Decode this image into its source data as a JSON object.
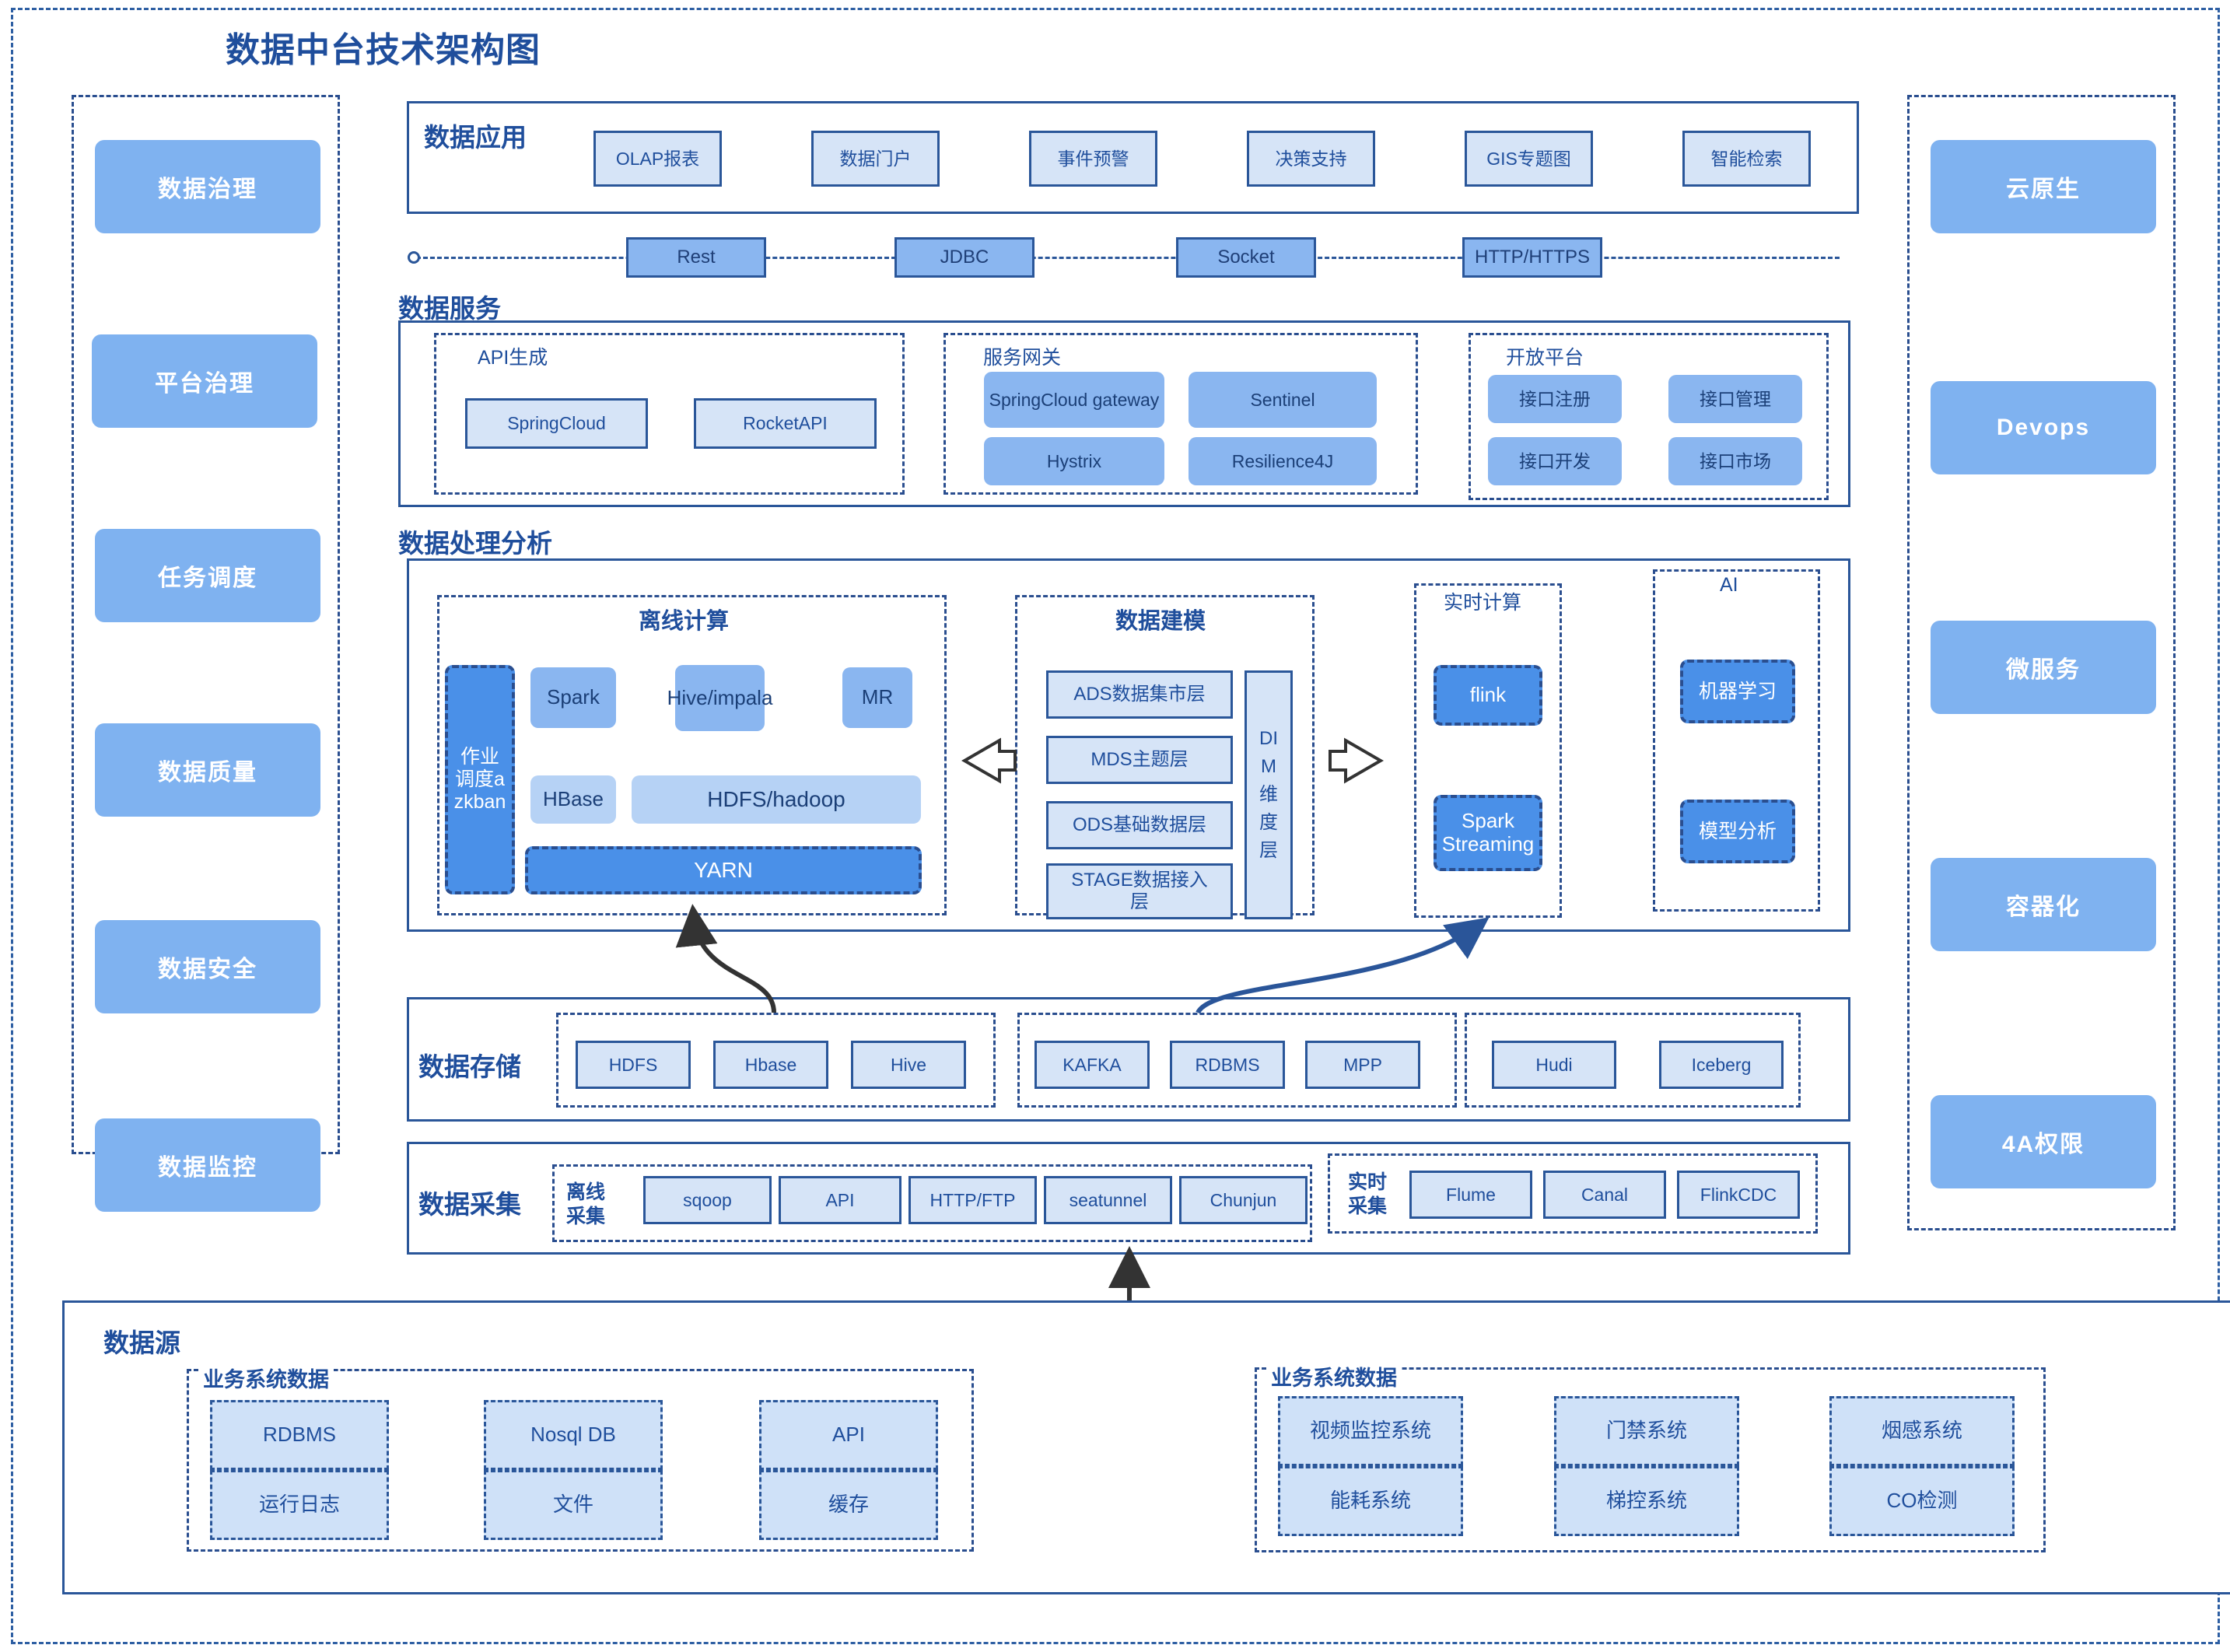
{
  "title": "数据中台技术架构图",
  "left_rail": {
    "items": [
      {
        "label": "数据治理"
      },
      {
        "label": "平台治理"
      },
      {
        "label": "任务调度"
      },
      {
        "label": "数据质量"
      },
      {
        "label": "数据安全"
      },
      {
        "label": "数据监控"
      }
    ]
  },
  "right_rail": {
    "items": [
      {
        "label": "云原生"
      },
      {
        "label": "Devops"
      },
      {
        "label": "微服务"
      },
      {
        "label": "容器化"
      },
      {
        "label": "4A权限"
      }
    ]
  },
  "data_application": {
    "label": "数据应用",
    "items": [
      "OLAP报表",
      "数据门户",
      "事件预警",
      "决策支持",
      "GIS专题图",
      "智能检索"
    ]
  },
  "service_bus": {
    "items": [
      "Rest",
      "JDBC",
      "Socket",
      "HTTP/HTTPS"
    ]
  },
  "data_service": {
    "label": "数据服务",
    "groups": [
      {
        "title": "API生成",
        "items": [
          "SpringCloud",
          "RocketAPI"
        ]
      },
      {
        "title": "服务网关",
        "items": [
          "SpringCloud gateway",
          "Sentinel",
          "Hystrix",
          "Resilience4J"
        ]
      },
      {
        "title": "开放平台",
        "items": [
          "接口注册",
          "接口管理",
          "接口开发",
          "接口市场"
        ]
      }
    ]
  },
  "data_processing": {
    "label": "数据处理分析",
    "offline": {
      "title": "离线计算",
      "scheduler": "作业调度azkban",
      "engines": [
        "Spark",
        "Hive/impala",
        "MR"
      ],
      "stores": [
        "HBase",
        "HDFS/hadoop"
      ],
      "resource": "YARN"
    },
    "modeling": {
      "title": "数据建模",
      "layers": [
        "ADS数据集市层",
        "MDS主题层",
        "ODS基础数据层",
        "STAGE数据接入层"
      ],
      "dim": "DIM维度层"
    },
    "realtime": {
      "title": "实时计算",
      "items": [
        "flink",
        "Spark Streaming"
      ]
    },
    "ai": {
      "title": "AI",
      "items": [
        "机器学习",
        "模型分析"
      ]
    }
  },
  "data_storage": {
    "label": "数据存储",
    "groups": [
      {
        "items": [
          "HDFS",
          "Hbase",
          "Hive"
        ]
      },
      {
        "items": [
          "KAFKA",
          "RDBMS",
          "MPP"
        ]
      },
      {
        "items": [
          "Hudi",
          "Iceberg"
        ]
      }
    ]
  },
  "data_collection": {
    "label": "数据采集",
    "offline": {
      "title": "离线\n采集",
      "items": [
        "sqoop",
        "API",
        "HTTP/FTP",
        "seatunnel",
        "Chunjun"
      ]
    },
    "realtime": {
      "title": "实时\n采集",
      "items": [
        "Flume",
        "Canal",
        "FlinkCDC"
      ]
    }
  },
  "data_source": {
    "label": "数据源",
    "groups": [
      {
        "title": "业务系统数据",
        "columns": [
          {
            "top": "RDBMS",
            "bottom": "运行日志"
          },
          {
            "top": "Nosql DB",
            "bottom": "文件"
          },
          {
            "top": "API",
            "bottom": "缓存"
          }
        ]
      },
      {
        "title": "业务系统数据",
        "columns": [
          {
            "top": "视频监控系统",
            "bottom": "能耗系统"
          },
          {
            "top": "门禁系统",
            "bottom": "梯控系统"
          },
          {
            "top": "烟感系统",
            "bottom": "CO检测"
          }
        ]
      }
    ]
  },
  "colors": {
    "frame": "#2e5fa3",
    "panel_border": "#2a5699",
    "title": "#1f4e9c",
    "rail_fill": "#7fb2f0",
    "node_light": "#d6e4f7",
    "node_mid": "#8ab6f0",
    "node_deep": "#4a90e8",
    "arrow_dark": "#333333",
    "arrow_blue": "#2a5599"
  }
}
